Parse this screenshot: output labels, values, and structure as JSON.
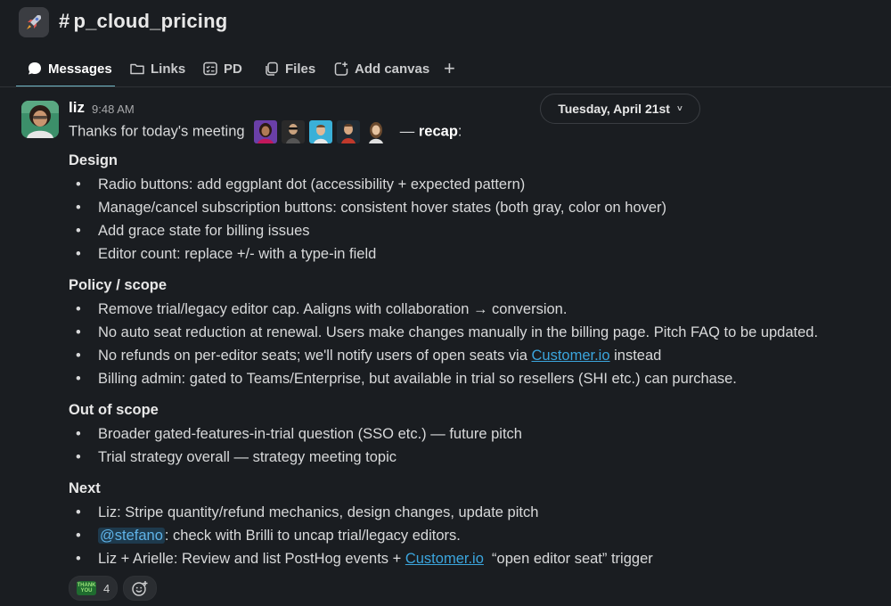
{
  "channel": {
    "hash": "#",
    "name": "p_cloud_pricing",
    "icon": "rocket-icon"
  },
  "tabs": [
    {
      "label": "Messages",
      "icon": "message-bubble-icon",
      "active": true
    },
    {
      "label": "Links",
      "icon": "folder-icon"
    },
    {
      "label": "PD",
      "icon": "checklist-icon"
    },
    {
      "label": "Files",
      "icon": "files-icon"
    },
    {
      "label": "Add canvas",
      "icon": "canvas-add-icon"
    }
  ],
  "add_tab_label": "+",
  "date_divider": {
    "label": "Tuesday, April 21st",
    "chevron": "˅"
  },
  "message": {
    "author": "liz",
    "time": "9:48 AM",
    "intro_text": "Thanks for today's meeting",
    "intro_dash": "—",
    "intro_bold": "recap",
    "intro_colon": ":",
    "sections": [
      {
        "heading": "Design",
        "items": [
          "Radio buttons: add eggplant dot (accessibility + expected pattern)",
          "Manage/cancel subscription buttons: consistent hover states (both gray, color on hover)",
          "Add grace state for billing issues",
          "Editor count: replace +/- with a type-in field"
        ]
      },
      {
        "heading": "Policy / scope",
        "items": [
          "Remove trial/legacy editor cap. Aaligns with collaboration → conversion.",
          "No auto seat reduction at renewal. Users make changes manually in the billing page. Pitch FAQ to be updated.",
          "Billing admin: gated to Teams/Enterprise, but available in trial so resellers (SHI etc.) can purchase."
        ],
        "refund_item": {
          "before": "No refunds on per-editor seats; we'll notify users of open seats via ",
          "link": "Customer.io",
          "after": " instead"
        }
      },
      {
        "heading": "Out of scope",
        "items": [
          "Broader gated-features-in-trial question (SSO etc.) — future pitch",
          "Trial strategy overall — strategy meeting topic"
        ]
      },
      {
        "heading": "Next",
        "items": [
          "Liz: Stripe quantity/refund mechanics, design changes, update pitch"
        ],
        "mention_item": {
          "mention": "@stefano",
          "after": ": check with Brilli to uncap trial/legacy editors."
        },
        "posthog_item": {
          "before": "Liz + Arielle: Review and list PostHog events + ",
          "link": "Customer.io",
          "after": "  “open editor seat” trigger"
        }
      }
    ],
    "bullet_char": "•",
    "reactions": [
      {
        "emoji": "thank-you-emoji",
        "emoji_text": "THANK YOU",
        "count": "4"
      },
      {
        "emoji": "add-reaction-icon"
      }
    ]
  },
  "colors": {
    "background": "#1a1d21",
    "accent_underline": "#6fb6c6",
    "link": "#3ba5dd",
    "mention_bg": "#1e3a4d"
  }
}
